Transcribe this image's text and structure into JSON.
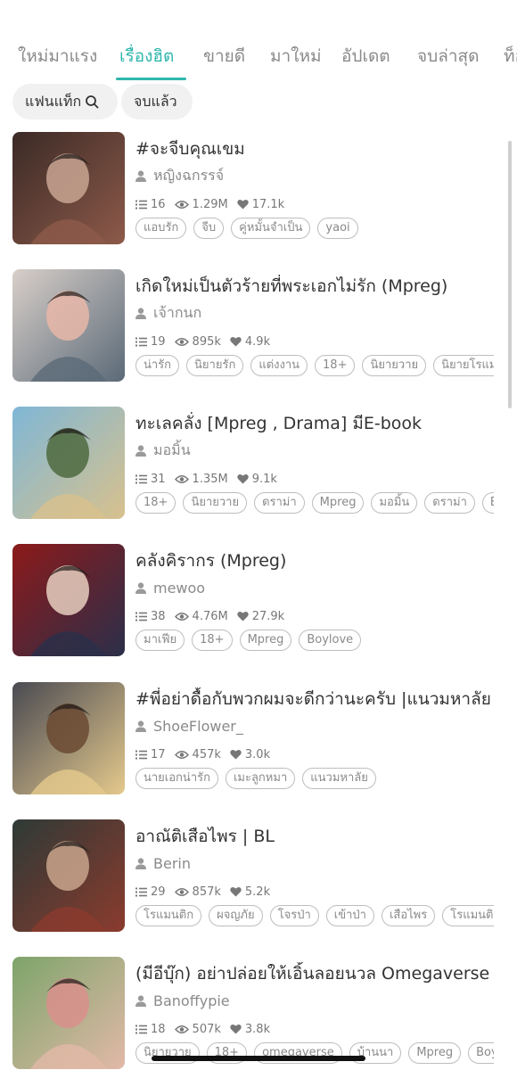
{
  "tabs": [
    {
      "label": "ใหม่มาแรง",
      "active": false
    },
    {
      "label": "เรื่องฮิต",
      "active": true
    },
    {
      "label": "ขายดี",
      "active": false
    },
    {
      "label": "มาใหม่",
      "active": false
    },
    {
      "label": "อัปเดต",
      "active": false
    },
    {
      "label": "จบล่าสุด",
      "active": false
    },
    {
      "label": "ท็อ",
      "active": false
    }
  ],
  "filters": {
    "fanfic_tag": "แฟนแท็ก",
    "completed": "จบแล้ว"
  },
  "colors": {
    "accent": "#2fb7ad",
    "muted": "#8a8a8a",
    "chip_bg": "#f1f1f1"
  },
  "novels": [
    {
      "title": "#จะจีบคุณเขม",
      "author": "หญิงฉกรรจ์",
      "chapters": "16",
      "views": "1.29M",
      "likes": "17.1k",
      "tags": [
        "แอบรัก",
        "จีบ",
        "คู่หมั้นจำเป็น",
        "yaoi"
      ],
      "cover_colors": [
        "#3b2a26",
        "#8d5a4a",
        "#c9a493"
      ]
    },
    {
      "title": "เกิดใหม่เป็นตัวร้ายที่พระเอกไม่รัก (Mpreg)",
      "author": "เจ้ากนก",
      "chapters": "19",
      "views": "895k",
      "likes": "4.9k",
      "tags": [
        "น่ารัก",
        "นิยายรัก",
        "แต่งงาน",
        "18+",
        "นิยายวาย",
        "นิยายโรแมนติก"
      ],
      "cover_colors": [
        "#d8cfc9",
        "#5b6a78",
        "#e7b7a8"
      ]
    },
    {
      "title": "ทะเลคลั่ง [Mpreg , Drama] มีE-book",
      "author": "มอมิ้น",
      "chapters": "31",
      "views": "1.35M",
      "likes": "9.1k",
      "tags": [
        "18+",
        "นิยายวาย",
        "ดราม่า",
        "Mpreg",
        "มอมิ้น",
        "ดราม่า",
        "BL"
      ],
      "cover_colors": [
        "#7fb7d6",
        "#d8c18d",
        "#4d6a3e"
      ]
    },
    {
      "title": "คลังคิรากร (Mpreg)",
      "author": "mewoo",
      "chapters": "38",
      "views": "4.76M",
      "likes": "27.9k",
      "tags": [
        "มาเฟีย",
        "18+",
        "Mpreg",
        "Boylove"
      ],
      "cover_colors": [
        "#8c1a1a",
        "#2b2f4a",
        "#e8cfc0"
      ]
    },
    {
      "title": "#พี่อย่าดื้อกับพวกผมจะดีกว่านะครับ |แนวมหาลัย",
      "author": "ShoeFlower_",
      "chapters": "17",
      "views": "457k",
      "likes": "3.0k",
      "tags": [
        "นายเอกน่ารัก",
        "เมะลูกหมา",
        "แนวมหาลัย"
      ],
      "cover_colors": [
        "#4a4a52",
        "#e4c98c",
        "#6b4a32"
      ]
    },
    {
      "title": "อาณัติเสือไพร | BL",
      "author": "Berin",
      "chapters": "29",
      "views": "857k",
      "likes": "5.2k",
      "tags": [
        "โรแมนติก",
        "ผจญภัย",
        "โจรป่า",
        "เข้าป่า",
        "เสือไพร",
        "โรแมนติก"
      ],
      "cover_colors": [
        "#2e3a36",
        "#8b3b2e",
        "#c9a58c"
      ]
    },
    {
      "title": "(มีอีบุ๊ก) อย่าปล่อยให้เอิ้นลอยนวล Omegaverse",
      "author": "Banoffypie",
      "chapters": "18",
      "views": "507k",
      "likes": "3.8k",
      "tags": [
        "นิยายวาย",
        "18+",
        "omegaverse",
        "บ้านนา",
        "Mpreg",
        "Boylove"
      ],
      "cover_colors": [
        "#7da46a",
        "#e2b9a8",
        "#d98f8c"
      ]
    }
  ]
}
